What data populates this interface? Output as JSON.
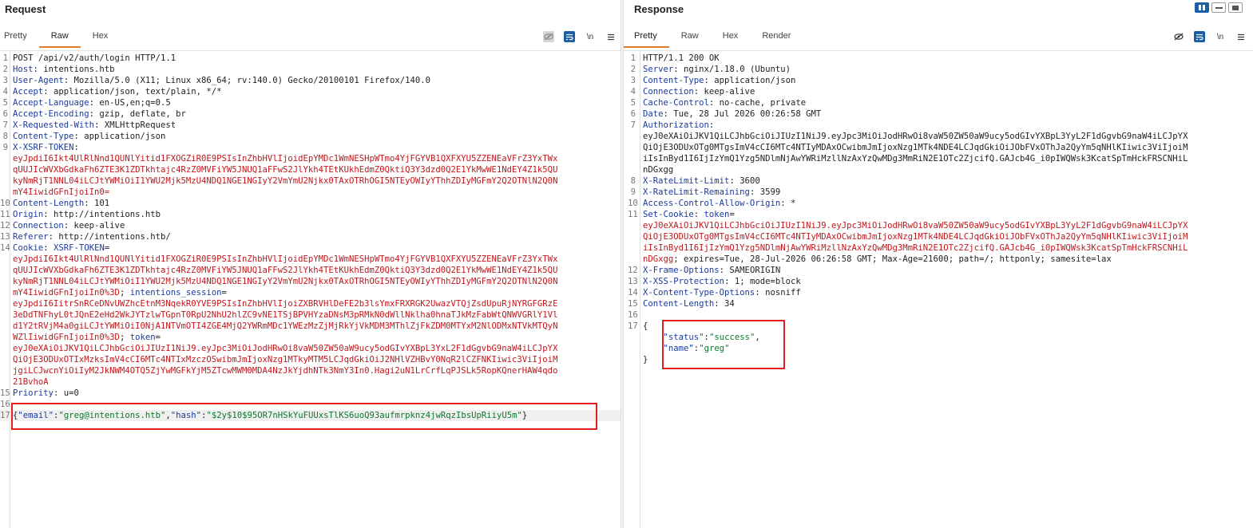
{
  "request": {
    "title": "Request",
    "tabs": [
      {
        "label": "Pretty"
      },
      {
        "label": "Raw",
        "active": true
      },
      {
        "label": "Hex"
      }
    ],
    "tools": [
      "hide-nonprintable-icon",
      "wrap-lines-icon",
      "newline-icon",
      "menu-icon"
    ],
    "newline_label": "\\n",
    "lines": [
      {
        "n": "1",
        "segs": [
          {
            "c": "dark",
            "t": "POST /api/v2/auth/login HTTP/1.1"
          }
        ]
      },
      {
        "n": "2",
        "segs": [
          {
            "c": "hk",
            "t": "Host"
          },
          {
            "c": "dark",
            "t": ": intentions.htb"
          }
        ]
      },
      {
        "n": "3",
        "segs": [
          {
            "c": "hk",
            "t": "User-Agent"
          },
          {
            "c": "dark",
            "t": ": Mozilla/5.0 (X11; Linux x86_64; rv:140.0) Gecko/20100101 Firefox/140.0"
          }
        ]
      },
      {
        "n": "4",
        "segs": [
          {
            "c": "hk",
            "t": "Accept"
          },
          {
            "c": "dark",
            "t": ": application/json, text/plain, */*"
          }
        ]
      },
      {
        "n": "5",
        "segs": [
          {
            "c": "hk",
            "t": "Accept-Language"
          },
          {
            "c": "dark",
            "t": ": en-US,en;q=0.5"
          }
        ]
      },
      {
        "n": "6",
        "segs": [
          {
            "c": "hk",
            "t": "Accept-Encoding"
          },
          {
            "c": "dark",
            "t": ": gzip, deflate, br"
          }
        ]
      },
      {
        "n": "7",
        "segs": [
          {
            "c": "hk",
            "t": "X-Requested-With"
          },
          {
            "c": "dark",
            "t": ": XMLHttpRequest"
          }
        ]
      },
      {
        "n": "8",
        "segs": [
          {
            "c": "hk",
            "t": "Content-Type"
          },
          {
            "c": "dark",
            "t": ": application/json"
          }
        ]
      },
      {
        "n": "9",
        "segs": [
          {
            "c": "hk",
            "t": "X-XSRF-TOKEN"
          },
          {
            "c": "dark",
            "t": ":"
          }
        ]
      },
      {
        "n": "",
        "segs": [
          {
            "c": "red",
            "t": "eyJpdiI6Ikt4UlRlNnd1QUNlYitid1FXOGZiR0E9PSIsInZhbHVlIjoidEpYMDc1WmNESHpWTmo4YjFGYVB1QXFXYU5ZZENEaVFrZ3YxTWx"
          }
        ]
      },
      {
        "n": "",
        "segs": [
          {
            "c": "red",
            "t": "qUUJIcWVXbGdkaFh6ZTE3K1ZDTkhtajc4RzZ0MVFiYW5JNUQ1aFFwS2JlYkh4TEtKUkhEdmZ0QktiQ3Y3dzd0Q2E1YkMwWE1NdEY4Z1k5QU"
          }
        ]
      },
      {
        "n": "",
        "segs": [
          {
            "c": "red",
            "t": "kyNmRjT1NNL04iLCJtYWMiOiI1YWU2Mjk5MzU4NDQ1NGE1NGIyY2VmYmU2Njkx0TAxOTRhOGI5NTEyOWIyYThhZDIyMGFmY2Q2OTNlN2Q0N"
          }
        ]
      },
      {
        "n": "",
        "segs": [
          {
            "c": "red",
            "t": "mY4IiwidGFnIjoiIn0="
          }
        ]
      },
      {
        "n": "10",
        "segs": [
          {
            "c": "hk",
            "t": "Content-Length"
          },
          {
            "c": "dark",
            "t": ": 101"
          }
        ]
      },
      {
        "n": "11",
        "segs": [
          {
            "c": "hk",
            "t": "Origin"
          },
          {
            "c": "dark",
            "t": ": http://intentions.htb"
          }
        ]
      },
      {
        "n": "12",
        "segs": [
          {
            "c": "hk",
            "t": "Connection"
          },
          {
            "c": "dark",
            "t": ": keep-alive"
          }
        ]
      },
      {
        "n": "13",
        "segs": [
          {
            "c": "hk",
            "t": "Referer"
          },
          {
            "c": "dark",
            "t": ": http://intentions.htb/"
          }
        ]
      },
      {
        "n": "14",
        "segs": [
          {
            "c": "hk",
            "t": "Cookie"
          },
          {
            "c": "dark",
            "t": ": "
          },
          {
            "c": "hk",
            "t": "XSRF-TOKEN"
          },
          {
            "c": "dark",
            "t": "="
          }
        ]
      },
      {
        "n": "",
        "segs": [
          {
            "c": "red",
            "t": "eyJpdiI6Ikt4UlRlNnd1QUNlYitid1FXOGZiR0E9PSIsInZhbHVlIjoidEpYMDc1WmNESHpWTmo4YjFGYVB1QXFXYU5ZZENEaVFrZ3YxTWx"
          }
        ]
      },
      {
        "n": "",
        "segs": [
          {
            "c": "red",
            "t": "qUUJIcWVXbGdkaFh6ZTE3K1ZDTkhtajc4RzZ0MVFiYW5JNUQ1aFFwS2JlYkh4TEtKUkhEdmZ0QktiQ3Y3dzd0Q2E1YkMwWE1NdEY4Z1k5QU"
          }
        ]
      },
      {
        "n": "",
        "segs": [
          {
            "c": "red",
            "t": "kyNmRjT1NNL04iLCJtYWMiOiI1YWU2Mjk5MzU4NDQ1NGE1NGIyY2VmYmU2Njkx0TAxOTRhOGI5NTEyOWIyYThhZDIyMGFmY2Q2OTNlN2Q0N"
          }
        ]
      },
      {
        "n": "",
        "segs": [
          {
            "c": "red",
            "t": "mY4IiwidGFnIjoiIn0%3D"
          },
          {
            "c": "dark",
            "t": "; "
          },
          {
            "c": "hk",
            "t": "intentions_session"
          },
          {
            "c": "dark",
            "t": "="
          }
        ]
      },
      {
        "n": "",
        "segs": [
          {
            "c": "red",
            "t": "eyJpdiI6IitrSnRCeDNvUWZhcEtnM3NqekR0YVE9PSIsInZhbHVlIjoiZXBRVHlDeFE2b3lsYmxFRXRGK2UwazVTQjZsdUpuRjNYRGFGRzE"
          }
        ]
      },
      {
        "n": "",
        "segs": [
          {
            "c": "red",
            "t": "3eDdTNFhyL0tJQnE2eHd2WkJYTzlwTGpnT0RpU2NhU2hlZC9vNE1TSjBPVHYzaDNsM3pRMkN0dWllNklha0hnaTJkMzFabWtQNWVGRlY1Vl"
          }
        ]
      },
      {
        "n": "",
        "segs": [
          {
            "c": "red",
            "t": "d1Y2tRVjM4a0giLCJtYWMiOiI0NjA1NTVmOTI4ZGE4MjQ2YWRmMDc1YWEzMzZjMjRkYjVkMDM3MThlZjFkZDM0MTYxM2NlODMxNTVkMTQyN"
          }
        ]
      },
      {
        "n": "",
        "segs": [
          {
            "c": "red",
            "t": "WZlIiwidGFnIjoiIn0%3D"
          },
          {
            "c": "dark",
            "t": "; "
          },
          {
            "c": "hk",
            "t": "token"
          },
          {
            "c": "dark",
            "t": "="
          }
        ]
      },
      {
        "n": "",
        "segs": [
          {
            "c": "red",
            "t": "eyJ0eXAiOiJKV1QiLCJhbGciOiJIUzI1NiJ9.eyJpc3MiOiJodHRwOi8vaW50ZW50aW9ucy5odGIvYXBpL3YxL2F1dGgvbG9naW4iLCJpYX"
          }
        ]
      },
      {
        "n": "",
        "segs": [
          {
            "c": "red",
            "t": "QiOjE3ODUxOTIxMzksImV4cCI6MTc4NTIxMzczOSwibmJmIjoxNzg1MTkyMTM5LCJqdGkiOiJ2NHlVZHBvY0NqR2lCZFNKIiwic3ViIjoiM"
          }
        ]
      },
      {
        "n": "",
        "segs": [
          {
            "c": "red",
            "t": "jgiLCJwcnYiOiIyM2JkNWM4OTQ5ZjYwMGFkYjM5ZTcwMWM0MDA4NzJkYjdhNTk3NmY3In0.Hagi2uN1LrCrfLqPJSLk5RopKQnerHAW4qdo"
          }
        ]
      },
      {
        "n": "",
        "segs": [
          {
            "c": "red",
            "t": "21BvhoA"
          }
        ]
      },
      {
        "n": "15",
        "segs": [
          {
            "c": "hk",
            "t": "Priority"
          },
          {
            "c": "dark",
            "t": ": u=0"
          }
        ]
      },
      {
        "n": "16",
        "segs": []
      },
      {
        "n": "17",
        "hl": true,
        "segs": [
          {
            "c": "dark",
            "t": "{"
          },
          {
            "c": "hk",
            "t": "\"email\""
          },
          {
            "c": "dark",
            "t": ":"
          },
          {
            "c": "str",
            "t": "\"greg@intentions.htb\""
          },
          {
            "c": "dark",
            "t": ","
          },
          {
            "c": "hk",
            "t": "\"hash\""
          },
          {
            "c": "dark",
            "t": ":"
          },
          {
            "c": "str",
            "t": "\"$2y$10$95OR7nHSkYuFUUxsTlKS6uoQ93aufmrpknz4jwRqzIbsUpRiiyU5m\""
          },
          {
            "c": "dark",
            "t": "}"
          }
        ]
      }
    ]
  },
  "response": {
    "title": "Response",
    "tabs": [
      {
        "label": "Pretty",
        "active": true
      },
      {
        "label": "Raw"
      },
      {
        "label": "Hex"
      },
      {
        "label": "Render"
      }
    ],
    "tools": [
      "hide-nonprintable-icon",
      "wrap-lines-icon",
      "newline-icon",
      "menu-icon"
    ],
    "newline_label": "\\n",
    "lines": [
      {
        "n": "1",
        "segs": [
          {
            "c": "dark",
            "t": "HTTP/1.1 200 OK"
          }
        ]
      },
      {
        "n": "2",
        "segs": [
          {
            "c": "hk",
            "t": "Server"
          },
          {
            "c": "dark",
            "t": ": nginx/1.18.0 (Ubuntu)"
          }
        ]
      },
      {
        "n": "3",
        "segs": [
          {
            "c": "hk",
            "t": "Content-Type"
          },
          {
            "c": "dark",
            "t": ": application/json"
          }
        ]
      },
      {
        "n": "4",
        "segs": [
          {
            "c": "hk",
            "t": "Connection"
          },
          {
            "c": "dark",
            "t": ": keep-alive"
          }
        ]
      },
      {
        "n": "5",
        "segs": [
          {
            "c": "hk",
            "t": "Cache-Control"
          },
          {
            "c": "dark",
            "t": ": no-cache, private"
          }
        ]
      },
      {
        "n": "6",
        "segs": [
          {
            "c": "hk",
            "t": "Date"
          },
          {
            "c": "dark",
            "t": ": Tue, 28 Jul 2026 00:26:58 GMT"
          }
        ]
      },
      {
        "n": "7",
        "segs": [
          {
            "c": "hk",
            "t": "Authorization"
          },
          {
            "c": "dark",
            "t": ":"
          }
        ]
      },
      {
        "n": "",
        "segs": [
          {
            "c": "dark",
            "t": "eyJ0eXAiOiJKV1QiLCJhbGciOiJIUzI1NiJ9.eyJpc3MiOiJodHRwOi8vaW50ZW50aW9ucy5odGIvYXBpL3YyL2F1dGgvbG9naW4iLCJpYX"
          }
        ]
      },
      {
        "n": "",
        "segs": [
          {
            "c": "dark",
            "t": "QiOjE3ODUxOTg0MTgsImV4cCI6MTc4NTIyMDAxOCwibmJmIjoxNzg1MTk4NDE4LCJqdGkiOiJObFVxOThJa2QyYm5qNHlKIiwic3ViIjoiM"
          }
        ]
      },
      {
        "n": "",
        "segs": [
          {
            "c": "dark",
            "t": "iIsInByd1I6IjIzYmQ1Yzg5NDlmNjAwYWRiMzllNzAxYzQwMDg3MmRiN2E1OTc2ZjcifQ.GAJcb4G_i0pIWQWsk3KcatSpTmHckFRSCNHiL"
          }
        ]
      },
      {
        "n": "",
        "segs": [
          {
            "c": "dark",
            "t": "nDGxgg"
          }
        ]
      },
      {
        "n": "8",
        "segs": [
          {
            "c": "hk",
            "t": "X-RateLimit-Limit"
          },
          {
            "c": "dark",
            "t": ": 3600"
          }
        ]
      },
      {
        "n": "9",
        "segs": [
          {
            "c": "hk",
            "t": "X-RateLimit-Remaining"
          },
          {
            "c": "dark",
            "t": ": 3599"
          }
        ]
      },
      {
        "n": "10",
        "segs": [
          {
            "c": "hk",
            "t": "Access-Control-Allow-Origin"
          },
          {
            "c": "dark",
            "t": ": *"
          }
        ]
      },
      {
        "n": "11",
        "segs": [
          {
            "c": "hk",
            "t": "Set-Cookie"
          },
          {
            "c": "dark",
            "t": ": "
          },
          {
            "c": "hk",
            "t": "token"
          },
          {
            "c": "dark",
            "t": "="
          }
        ]
      },
      {
        "n": "",
        "segs": [
          {
            "c": "red",
            "t": "eyJ0eXAiOiJKV1QiLCJhbGciOiJIUzI1NiJ9.eyJpc3MiOiJodHRwOi8vaW50ZW50aW9ucy5odGIvYXBpL3YyL2F1dGgvbG9naW4iLCJpYX"
          }
        ]
      },
      {
        "n": "",
        "segs": [
          {
            "c": "red",
            "t": "QiOjE3ODUxOTg0MTgsImV4cCI6MTc4NTIyMDAxOCwibmJmIjoxNzg1MTk4NDE4LCJqdGkiOiJObFVxOThJa2QyYm5qNHlKIiwic3ViIjoiM"
          }
        ]
      },
      {
        "n": "",
        "segs": [
          {
            "c": "red",
            "t": "iIsInByd1I6IjIzYmQ1Yzg5NDlmNjAwYWRiMzllNzAxYzQwMDg3MmRiN2E1OTc2ZjcifQ.GAJcb4G_i0pIWQWsk3KcatSpTmHckFRSCNHiL"
          }
        ]
      },
      {
        "n": "",
        "segs": [
          {
            "c": "red",
            "t": "nDGxgg"
          },
          {
            "c": "dark",
            "t": "; expires=Tue, 28-Jul-2026 06:26:58 GMT; Max-Age=21600; path=/; httponly; samesite=lax"
          }
        ]
      },
      {
        "n": "12",
        "segs": [
          {
            "c": "hk",
            "t": "X-Frame-Options"
          },
          {
            "c": "dark",
            "t": ": SAMEORIGIN"
          }
        ]
      },
      {
        "n": "13",
        "segs": [
          {
            "c": "hk",
            "t": "X-XSS-Protection"
          },
          {
            "c": "dark",
            "t": ": 1; mode=block"
          }
        ]
      },
      {
        "n": "14",
        "segs": [
          {
            "c": "hk",
            "t": "X-Content-Type-Options"
          },
          {
            "c": "dark",
            "t": ": nosniff"
          }
        ]
      },
      {
        "n": "15",
        "segs": [
          {
            "c": "hk",
            "t": "Content-Length"
          },
          {
            "c": "dark",
            "t": ": 34"
          }
        ]
      },
      {
        "n": "16",
        "segs": []
      },
      {
        "n": "17",
        "segs": [
          {
            "c": "dark",
            "t": "{"
          }
        ]
      },
      {
        "n": "",
        "segs": [
          {
            "c": "dark",
            "t": "    "
          },
          {
            "c": "hk",
            "t": "\"status\""
          },
          {
            "c": "dark",
            "t": ":"
          },
          {
            "c": "str",
            "t": "\"success\""
          },
          {
            "c": "dark",
            "t": ","
          }
        ]
      },
      {
        "n": "",
        "segs": [
          {
            "c": "dark",
            "t": "    "
          },
          {
            "c": "hk",
            "t": "\"name\""
          },
          {
            "c": "dark",
            "t": ":"
          },
          {
            "c": "str",
            "t": "\"greg\""
          }
        ]
      },
      {
        "n": "",
        "segs": [
          {
            "c": "dark",
            "t": "}"
          }
        ]
      }
    ]
  },
  "view_toggle": [
    "split-horizontal-icon",
    "split-vertical-icon",
    "single-pane-icon"
  ],
  "colors": {
    "header_key": "#1a3a9e",
    "token_red": "#c0181d",
    "json_string": "#0b7a2a",
    "active_tab": "#e07b27",
    "highlight_box": "#e02020",
    "selected_tool": "#1a5fa6"
  }
}
